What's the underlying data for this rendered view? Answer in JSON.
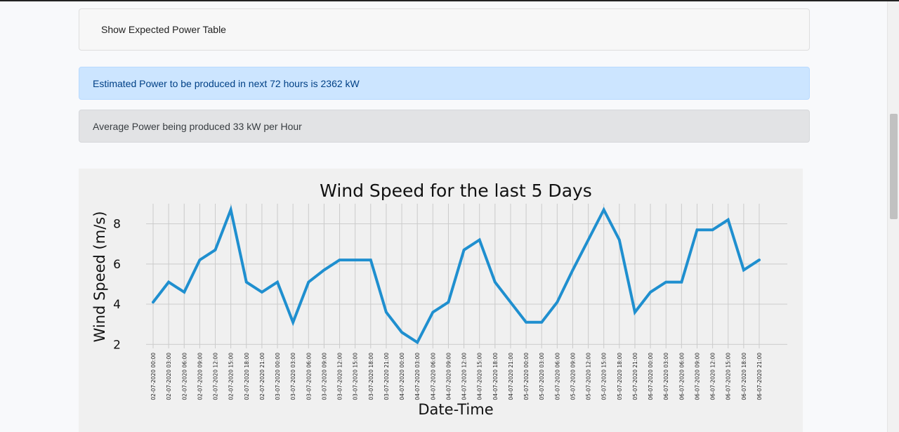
{
  "panel": {
    "toggle_label": "Show Expected Power Table"
  },
  "alerts": {
    "estimated": "Estimated Power to be produced in next 72 hours is 2362 kW",
    "average": "Average Power being produced 33 kW per Hour"
  },
  "colors": {
    "line": "#1f8fcf",
    "grid": "#cbcbcb",
    "chart_bg": "#f0f0f0"
  },
  "chart_data": {
    "type": "line",
    "title": "Wind Speed for the last 5 Days",
    "xlabel": "Date-Time",
    "ylabel": "Wind Speed (m/s)",
    "ylim": [
      1.8,
      9.0
    ],
    "yticks": [
      2,
      4,
      6,
      8
    ],
    "grid": true,
    "categories": [
      "02-07-2020 00:00",
      "02-07-2020 03:00",
      "02-07-2020 06:00",
      "02-07-2020 09:00",
      "02-07-2020 12:00",
      "02-07-2020 15:00",
      "02-07-2020 18:00",
      "02-07-2020 21:00",
      "03-07-2020 00:00",
      "03-07-2020 03:00",
      "03-07-2020 06:00",
      "03-07-2020 09:00",
      "03-07-2020 12:00",
      "03-07-2020 15:00",
      "03-07-2020 18:00",
      "03-07-2020 21:00",
      "04-07-2020 00:00",
      "04-07-2020 03:00",
      "04-07-2020 06:00",
      "04-07-2020 09:00",
      "04-07-2020 12:00",
      "04-07-2020 15:00",
      "04-07-2020 18:00",
      "04-07-2020 21:00",
      "05-07-2020 00:00",
      "05-07-2020 03:00",
      "05-07-2020 06:00",
      "05-07-2020 09:00",
      "05-07-2020 12:00",
      "05-07-2020 15:00",
      "05-07-2020 18:00",
      "05-07-2020 21:00",
      "06-07-2020 00:00",
      "06-07-2020 03:00",
      "06-07-2020 06:00",
      "06-07-2020 09:00",
      "06-07-2020 12:00",
      "06-07-2020 15:00",
      "06-07-2020 18:00",
      "06-07-2020 21:00"
    ],
    "series": [
      {
        "values": [
          4.1,
          5.1,
          4.6,
          6.2,
          6.7,
          8.7,
          5.1,
          4.6,
          5.1,
          3.1,
          5.1,
          5.7,
          6.2,
          6.2,
          6.2,
          3.6,
          2.6,
          2.1,
          3.6,
          4.1,
          6.7,
          7.2,
          5.1,
          4.1,
          3.1,
          3.1,
          4.1,
          5.7,
          7.2,
          8.7,
          7.2,
          3.6,
          4.6,
          5.1,
          5.1,
          7.7,
          7.7,
          8.2,
          5.7,
          6.2
        ]
      }
    ]
  }
}
